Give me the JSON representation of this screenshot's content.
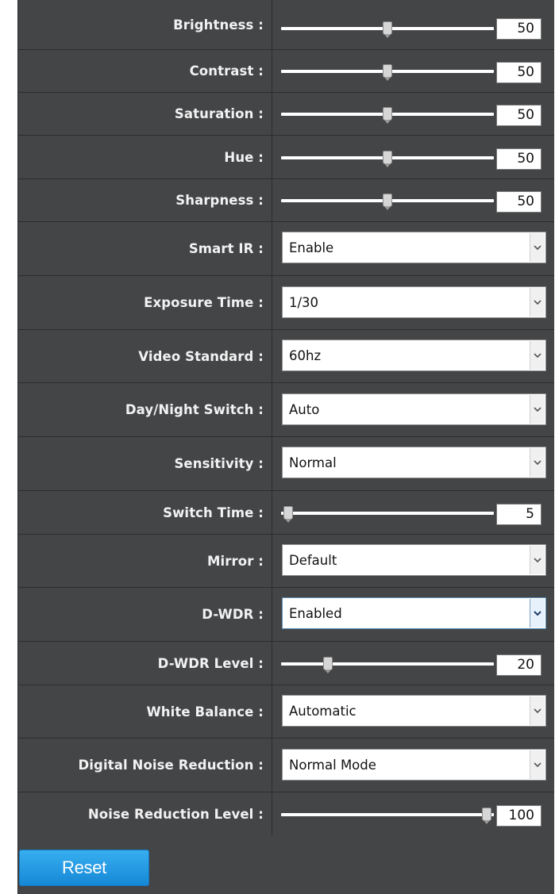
{
  "settings": {
    "brightness": {
      "label": "Brightness :",
      "value": "50",
      "level": 0.5
    },
    "contrast": {
      "label": "Contrast :",
      "value": "50",
      "level": 0.5
    },
    "saturation": {
      "label": "Saturation :",
      "value": "50",
      "level": 0.5
    },
    "hue": {
      "label": "Hue :",
      "value": "50",
      "level": 0.5
    },
    "sharpness": {
      "label": "Sharpness :",
      "value": "50",
      "level": 0.5
    },
    "smart_ir": {
      "label": "Smart IR :",
      "selected": "Enable"
    },
    "exposure_time": {
      "label": "Exposure Time :",
      "selected": "1/30"
    },
    "video_standard": {
      "label": "Video Standard :",
      "selected": "60hz"
    },
    "day_night_switch": {
      "label": "Day/Night Switch :",
      "selected": "Auto"
    },
    "sensitivity": {
      "label": "Sensitivity :",
      "selected": "Normal"
    },
    "switch_time": {
      "label": "Switch Time :",
      "value": "5",
      "level": 0.0
    },
    "mirror": {
      "label": "Mirror :",
      "selected": "Default"
    },
    "d_wdr": {
      "label": "D-WDR :",
      "selected": "Enabled"
    },
    "d_wdr_level": {
      "label": "D-WDR Level :",
      "value": "20",
      "level": 0.2
    },
    "white_balance": {
      "label": "White Balance :",
      "selected": "Automatic"
    },
    "digital_noise_reduction": {
      "label": "Digital Noise Reduction :",
      "selected": "Normal Mode"
    },
    "noise_reduction_level": {
      "label": "Noise Reduction Level :",
      "value": "100",
      "level": 1.0
    }
  },
  "reset_label": "Reset",
  "colors": {
    "panel_bg": "#444547",
    "accent": "#1a8fdd"
  },
  "icons": {
    "dropdown": "chevron-down-icon",
    "slider": "slider-thumb-icon"
  }
}
